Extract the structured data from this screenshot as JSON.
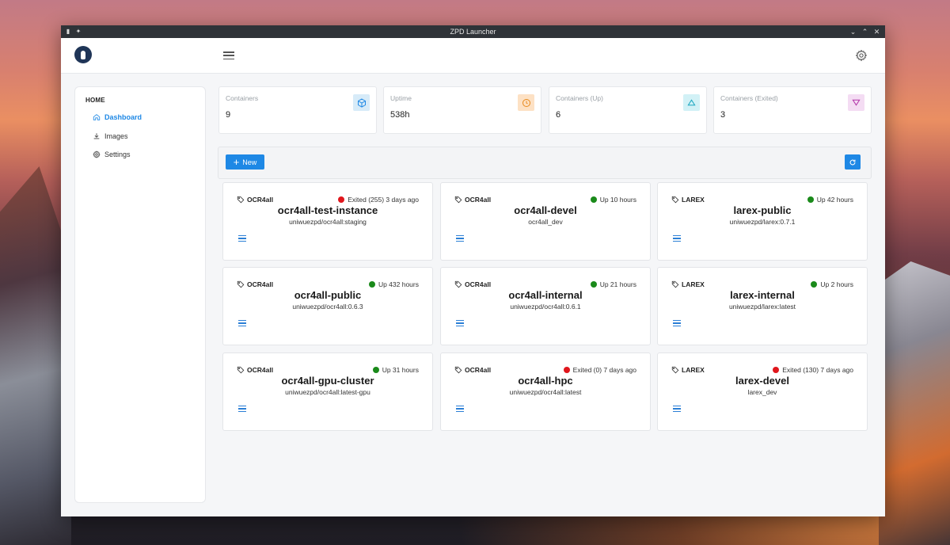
{
  "window": {
    "title": "ZPD Launcher"
  },
  "icons": {
    "logo": "zpd-logo-icon",
    "menu": "hamburger-menu-icon",
    "settings": "gear-icon",
    "tag": "tag-icon",
    "container": "cube-icon",
    "uptime": "clock-icon",
    "up": "triangle-up-icon",
    "exited": "triangle-down-icon"
  },
  "colors": {
    "accent": "#1e88e5",
    "status_up": "#1a8a1a",
    "status_exited": "#e0161c"
  },
  "sidebar": {
    "heading": "HOME",
    "items": [
      {
        "label": "Dashboard",
        "icon": "home-icon",
        "active": true
      },
      {
        "label": "Images",
        "icon": "download-icon",
        "active": false
      },
      {
        "label": "Settings",
        "icon": "gear-icon",
        "active": false
      }
    ]
  },
  "stats": [
    {
      "label": "Containers",
      "value": "9",
      "icon": "cube-icon",
      "color": "#d7ebf8"
    },
    {
      "label": "Uptime",
      "value": "538h",
      "icon": "clock-icon",
      "color": "#fde1c4"
    },
    {
      "label": "Containers (Up)",
      "value": "6",
      "icon": "triangle-up-icon",
      "color": "#d2f1f6"
    },
    {
      "label": "Containers (Exited)",
      "value": "3",
      "icon": "triangle-down-icon",
      "color": "#f4dcf3"
    }
  ],
  "toolbar": {
    "new_label": "New"
  },
  "containers": [
    {
      "tag": "OCR4all",
      "name": "ocr4all-test-instance",
      "image": "uniwuezpd/ocr4all:staging",
      "status": "Exited (255) 3 days ago",
      "state": "exited"
    },
    {
      "tag": "OCR4all",
      "name": "ocr4all-devel",
      "image": "ocr4all_dev",
      "status": "Up 10 hours",
      "state": "up"
    },
    {
      "tag": "LAREX",
      "name": "larex-public",
      "image": "uniwuezpd/larex:0.7.1",
      "status": "Up 42 hours",
      "state": "up"
    },
    {
      "tag": "OCR4all",
      "name": "ocr4all-public",
      "image": "uniwuezpd/ocr4all:0.6.3",
      "status": "Up 432 hours",
      "state": "up"
    },
    {
      "tag": "OCR4all",
      "name": "ocr4all-internal",
      "image": "uniwuezpd/ocr4all:0.6.1",
      "status": "Up 21 hours",
      "state": "up"
    },
    {
      "tag": "LAREX",
      "name": "larex-internal",
      "image": "uniwuezpd/larex:latest",
      "status": "Up 2 hours",
      "state": "up"
    },
    {
      "tag": "OCR4all",
      "name": "ocr4all-gpu-cluster",
      "image": "uniwuezpd/ocr4all:latest-gpu",
      "status": "Up 31 hours",
      "state": "up"
    },
    {
      "tag": "OCR4all",
      "name": "ocr4all-hpc",
      "image": "uniwuezpd/ocr4all:latest",
      "status": "Exited (0) 7 days ago",
      "state": "exited"
    },
    {
      "tag": "LAREX",
      "name": "larex-devel",
      "image": "larex_dev",
      "status": "Exited (130) 7 days ago",
      "state": "exited"
    }
  ]
}
